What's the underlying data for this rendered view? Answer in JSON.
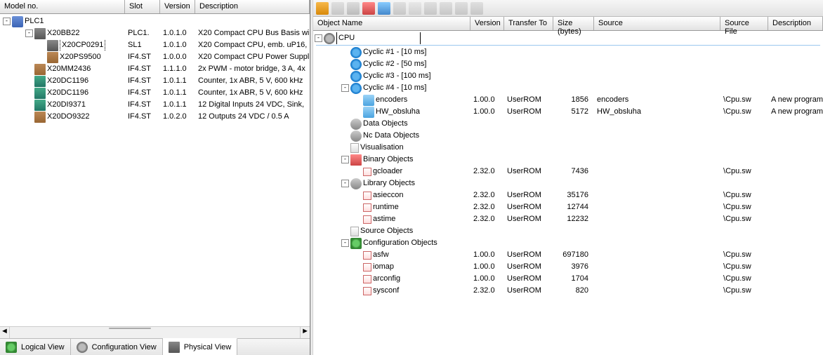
{
  "left": {
    "headers": {
      "model": "Model no.",
      "slot": "Slot",
      "version": "Version",
      "desc": "Description"
    },
    "root": "PLC1",
    "rows": [
      {
        "name": "X20BB22",
        "slot": "PLC1.",
        "ver": "1.0.1.0",
        "desc": "X20 Compact CPU Bus Basis wi",
        "icon": "i-mod",
        "indent": 1
      },
      {
        "name": "X20CP0291",
        "slot": "SL1",
        "ver": "1.0.1.0",
        "desc": "X20 Compact CPU, emb. uP16,",
        "icon": "i-mod",
        "indent": 2,
        "selected": true
      },
      {
        "name": "X20PS9500",
        "slot": "IF4.ST",
        "ver": "1.0.0.0",
        "desc": "X20 Compact CPU Power Suppl",
        "icon": "i-mod2",
        "indent": 2
      },
      {
        "name": "X20MM2436",
        "slot": "IF4.ST",
        "ver": "1.1.1.0",
        "desc": "2x PWM - motor bridge, 3 A, 4x",
        "icon": "i-mod2",
        "indent": 1
      },
      {
        "name": "X20DC1196",
        "slot": "IF4.ST",
        "ver": "1.0.1.1",
        "desc": "Counter, 1x ABR, 5 V, 600 kHz",
        "icon": "i-mod3",
        "indent": 1
      },
      {
        "name": "X20DC1196",
        "slot": "IF4.ST",
        "ver": "1.0.1.1",
        "desc": "Counter, 1x ABR, 5 V, 600 kHz",
        "icon": "i-mod3",
        "indent": 1
      },
      {
        "name": "X20DI9371",
        "slot": "IF4.ST",
        "ver": "1.0.1.1",
        "desc": "12 Digital Inputs 24 VDC, Sink,",
        "icon": "i-mod3",
        "indent": 1
      },
      {
        "name": "X20DO9322",
        "slot": "IF4.ST",
        "ver": "1.0.2.0",
        "desc": "12 Outputs 24 VDC / 0.5 A",
        "icon": "i-mod2",
        "indent": 1
      }
    ],
    "tabs": {
      "logical": "Logical View",
      "config": "Configuration View",
      "physical": "Physical View"
    }
  },
  "right": {
    "headers": {
      "name": "Object Name",
      "ver": "Version",
      "tt": "Transfer To",
      "size": "Size (bytes)",
      "src": "Source",
      "sf": "Source File",
      "desc": "Description"
    },
    "root": "CPU",
    "nodes": [
      {
        "type": "group",
        "name": "Cyclic #1 - [10 ms]",
        "icon": "i-refresh",
        "indent": 2
      },
      {
        "type": "group",
        "name": "Cyclic #2 - [50 ms]",
        "icon": "i-refresh",
        "indent": 2
      },
      {
        "type": "group",
        "name": "Cyclic #3 - [100 ms]",
        "icon": "i-refresh",
        "indent": 2
      },
      {
        "type": "group",
        "name": "Cyclic #4 - [10 ms]",
        "icon": "i-refresh",
        "indent": 2,
        "expanded": true
      },
      {
        "type": "item",
        "name": "encoders",
        "icon": "i-cube",
        "indent": 3,
        "ver": "1.00.0",
        "tt": "UserROM",
        "size": "1856",
        "src": "encoders",
        "sf": "\\Cpu.sw",
        "desc": "A new program"
      },
      {
        "type": "item",
        "name": "HW_obsluha",
        "icon": "i-cube",
        "indent": 3,
        "ver": "1.00.0",
        "tt": "UserROM",
        "size": "5172",
        "src": "HW_obsluha",
        "sf": "\\Cpu.sw",
        "desc": "A new program"
      },
      {
        "type": "group",
        "name": "Data Objects",
        "icon": "i-disk",
        "indent": 2
      },
      {
        "type": "group",
        "name": "Nc Data Objects",
        "icon": "i-disk",
        "indent": 2
      },
      {
        "type": "group",
        "name": "Visualisation",
        "icon": "i-doc",
        "indent": 2
      },
      {
        "type": "group",
        "name": "Binary Objects",
        "icon": "i-bin",
        "indent": 2,
        "expanded": true
      },
      {
        "type": "item",
        "name": "gcloader",
        "icon": "i-a",
        "indent": 3,
        "ver": "2.32.0",
        "tt": "UserROM",
        "size": "7436",
        "src": "",
        "sf": "\\Cpu.sw",
        "desc": ""
      },
      {
        "type": "group",
        "name": "Library Objects",
        "icon": "i-disk",
        "indent": 2,
        "expanded": true
      },
      {
        "type": "item",
        "name": "asieccon",
        "icon": "i-a",
        "indent": 3,
        "ver": "2.32.0",
        "tt": "UserROM",
        "size": "35176",
        "src": "",
        "sf": "\\Cpu.sw",
        "desc": ""
      },
      {
        "type": "item",
        "name": "runtime",
        "icon": "i-a",
        "indent": 3,
        "ver": "2.32.0",
        "tt": "UserROM",
        "size": "12744",
        "src": "",
        "sf": "\\Cpu.sw",
        "desc": ""
      },
      {
        "type": "item",
        "name": "astime",
        "icon": "i-a",
        "indent": 3,
        "ver": "2.32.0",
        "tt": "UserROM",
        "size": "12232",
        "src": "",
        "sf": "\\Cpu.sw",
        "desc": ""
      },
      {
        "type": "group",
        "name": "Source Objects",
        "icon": "i-doc",
        "indent": 2
      },
      {
        "type": "group",
        "name": "Configuration Objects",
        "icon": "i-cfg",
        "indent": 2,
        "expanded": true
      },
      {
        "type": "item",
        "name": "asfw",
        "icon": "i-a",
        "indent": 3,
        "ver": "1.00.0",
        "tt": "UserROM",
        "size": "697180",
        "src": "",
        "sf": "\\Cpu.sw",
        "desc": ""
      },
      {
        "type": "item",
        "name": "iomap",
        "icon": "i-a",
        "indent": 3,
        "ver": "1.00.0",
        "tt": "UserROM",
        "size": "3976",
        "src": "",
        "sf": "\\Cpu.sw",
        "desc": ""
      },
      {
        "type": "item",
        "name": "arconfig",
        "icon": "i-a",
        "indent": 3,
        "ver": "1.00.0",
        "tt": "UserROM",
        "size": "1704",
        "src": "",
        "sf": "\\Cpu.sw",
        "desc": ""
      },
      {
        "type": "item",
        "name": "sysconf",
        "icon": "i-a",
        "indent": 3,
        "ver": "2.32.0",
        "tt": "UserROM",
        "size": "820",
        "src": "",
        "sf": "\\Cpu.sw",
        "desc": ""
      }
    ]
  }
}
